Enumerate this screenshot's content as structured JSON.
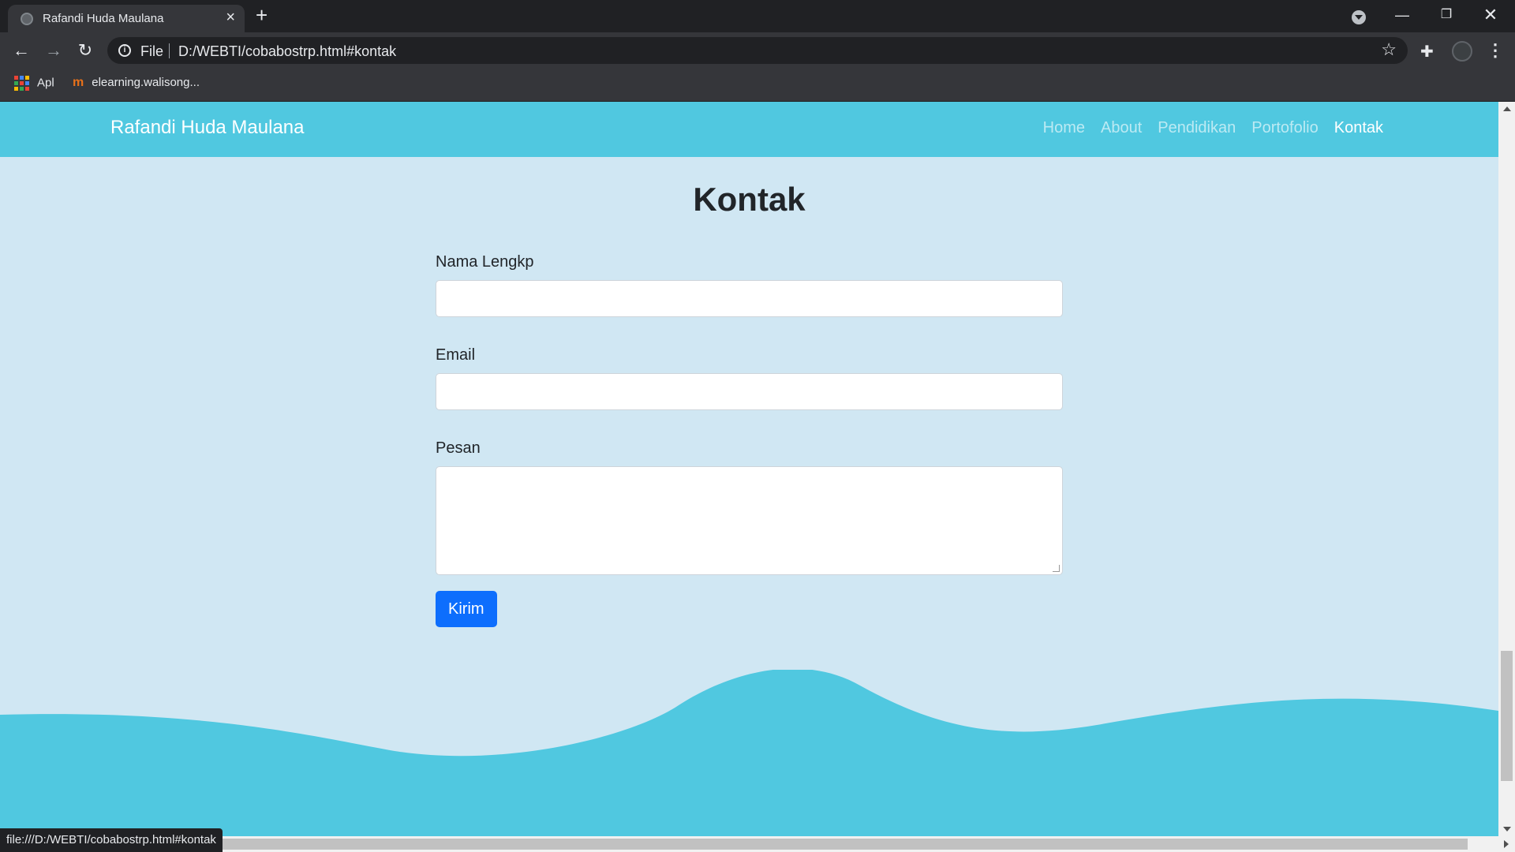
{
  "browser": {
    "tab_title": "Rafandi Huda Maulana",
    "scheme_label": "File",
    "url": "D:/WEBTI/cobabostrp.html#kontak",
    "bookmarks": [
      "Apl",
      "elearning.walisong..."
    ],
    "status_url": "file:///D:/WEBTI/cobabostrp.html#kontak"
  },
  "site": {
    "brand": "Rafandi Huda Maulana",
    "nav": [
      "Home",
      "About",
      "Pendidikan",
      "Portofolio",
      "Kontak"
    ],
    "active_nav": "Kontak",
    "nav_color": "#50c8e0",
    "background_color": "#d0e7f3"
  },
  "contact": {
    "title": "Kontak",
    "name_label": "Nama Lengkp",
    "email_label": "Email",
    "message_label": "Pesan",
    "submit_label": "Kirim",
    "button_color": "#0d6efd"
  },
  "icons": [
    "globe-icon",
    "close-icon",
    "plus-icon",
    "tab-search-icon",
    "back-arrow-icon",
    "forward-arrow-icon",
    "reload-icon",
    "info-icon",
    "star-icon",
    "puzzle-icon",
    "avatar",
    "kebab-menu-icon",
    "apps-grid-icon",
    "moodle-icon"
  ]
}
